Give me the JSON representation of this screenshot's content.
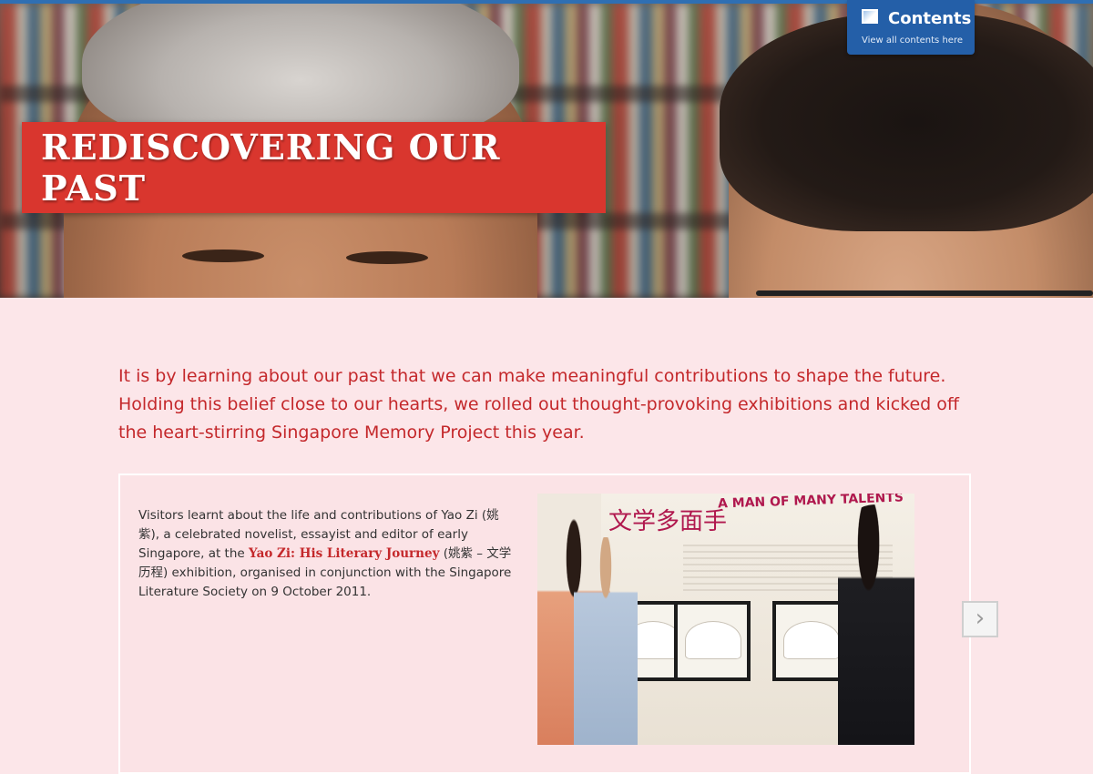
{
  "hero": {
    "title": "REDISCOVERING OUR PAST"
  },
  "contents_tab": {
    "title": "Contents",
    "subtitle": "View all contents here",
    "icon": "contents-icon"
  },
  "intro": {
    "text": "It is by learning about our past that we can make meaningful contributions to shape the future. Holding this belief close to our hearts, we rolled out thought-provoking exhibitions and kicked off the heart-stirring Singapore Memory Project this year."
  },
  "slide": {
    "text_before_link": "Visitors learnt about the life and contributions of Yao Zi (姚紫), a celebrated novelist, essayist and editor of early Singapore, at the ",
    "link_label": "Yao Zi: His Literary Journey",
    "text_after_link": " (姚紫 – 文学历程) exhibition, organised in conjunction with the Singapore Literature Society on 9 October 2011.",
    "photo_heading_cn": "文学多面手",
    "photo_heading_en": "A MAN OF MANY TALENTS"
  },
  "navigation": {
    "next_symbol": "›",
    "next_icon": "chevron-right-icon"
  },
  "colors": {
    "accent_red": "#d9362e",
    "intro_red": "#c4282b",
    "tab_blue": "#245fa8",
    "page_bg": "#fce6e9"
  }
}
